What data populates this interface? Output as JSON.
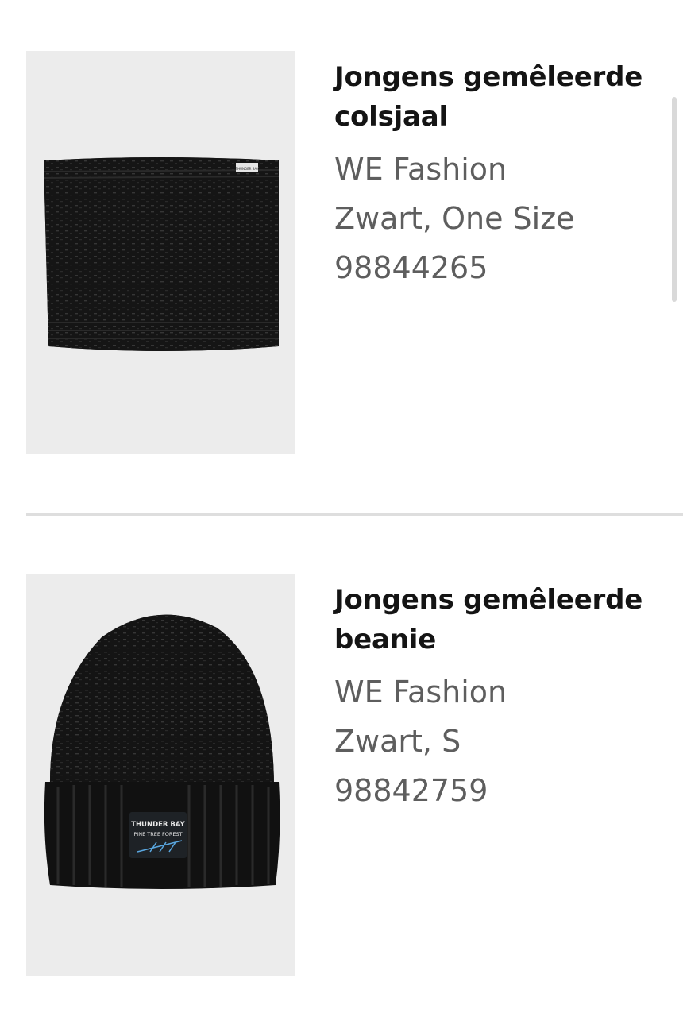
{
  "products": [
    {
      "title": "Jongens gemêleerde colsjaal",
      "brand": "WE Fashion",
      "variant": "Zwart, One Size",
      "article_number": "98844265",
      "image_label": [
        "THUNDER BAY",
        "PINE TREE FOREST"
      ]
    },
    {
      "title": "Jongens gemêleerde beanie",
      "brand": "WE Fashion",
      "variant": "Zwart, S",
      "article_number": "98842759",
      "image_label": [
        "THUNDER BAY",
        "PINE TREE FOREST"
      ]
    }
  ],
  "colors": {
    "background": "#ffffff",
    "image_background": "#ececec",
    "knit": "#141414",
    "title_text": "#141414",
    "meta_text": "#5e5e5e",
    "divider": "#dedede",
    "patch_accent": "#5aa7e0"
  }
}
